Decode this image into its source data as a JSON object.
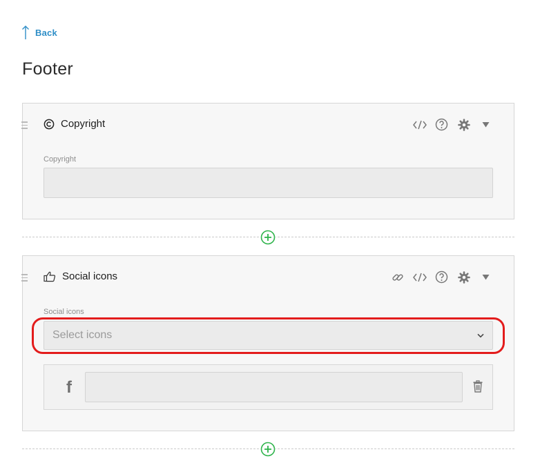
{
  "nav": {
    "back_label": "Back"
  },
  "page": {
    "title": "Footer"
  },
  "copyright_block": {
    "title": "Copyright",
    "field_label": "Copyright",
    "field_value": ""
  },
  "social_block": {
    "title": "Social icons",
    "field_label": "Social icons",
    "select_placeholder": "Select icons",
    "rows": [
      {
        "icon": "f",
        "value": ""
      }
    ]
  },
  "colors": {
    "accent": "#2f8ec7",
    "add": "#2db34a",
    "highlight": "#e31c1c"
  },
  "icons": {
    "back": "arrow-up-icon",
    "copyright": "copyright-icon",
    "social": "thumbs-up-icon",
    "code": "code-icon",
    "help": "help-icon",
    "settings": "gear-icon",
    "collapse": "caret-down-icon",
    "link": "link-icon",
    "facebook": "facebook-icon",
    "delete": "trash-icon",
    "add": "plus-circle-icon",
    "drag": "drag-handle-icon"
  }
}
